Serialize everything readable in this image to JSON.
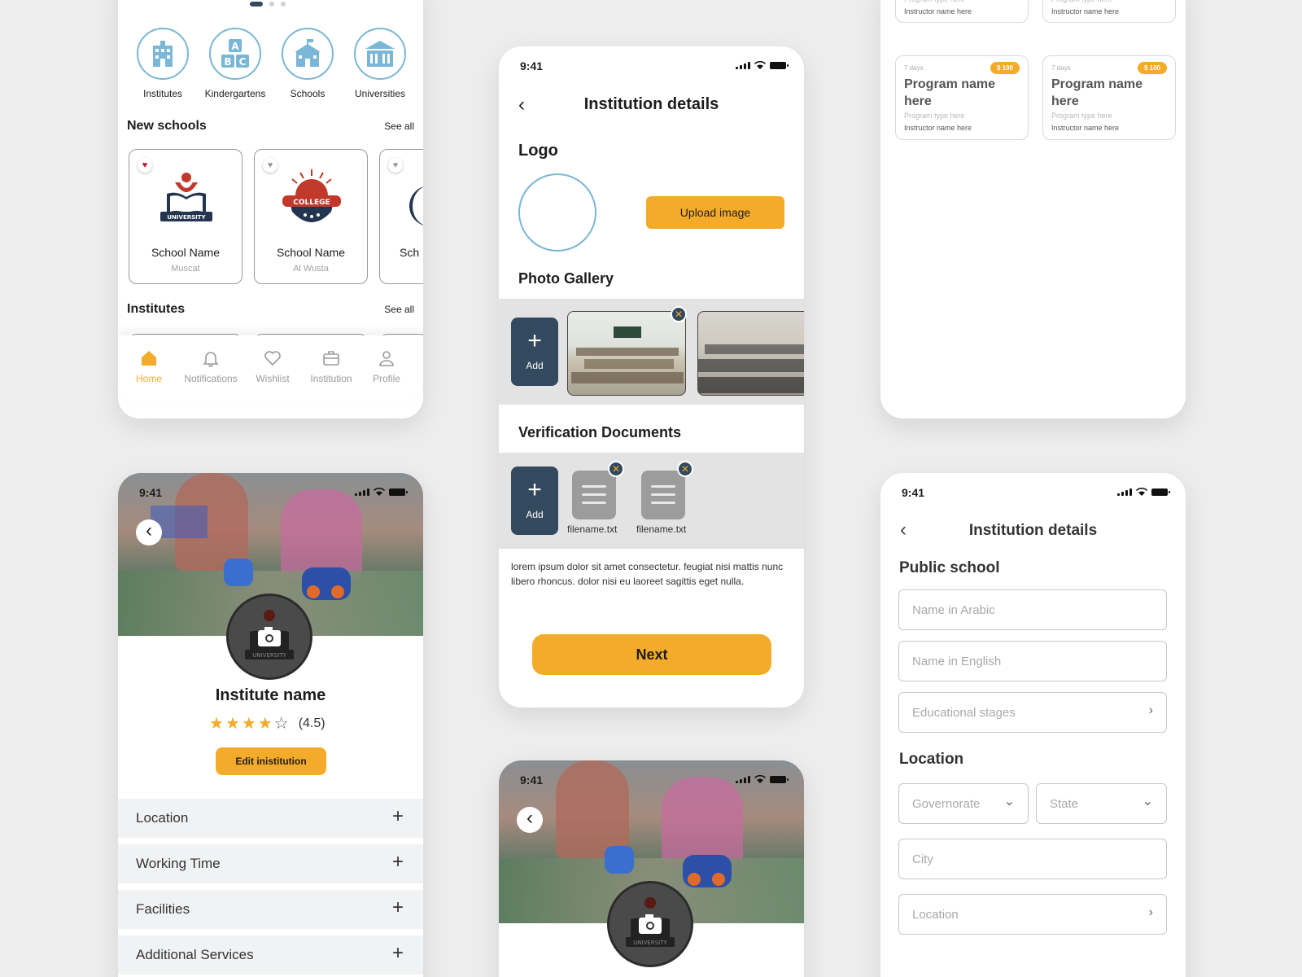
{
  "home": {
    "categories": [
      {
        "label": "Institutes",
        "icon": "building-icon"
      },
      {
        "label": "Kindergartens",
        "icon": "abc-blocks-icon"
      },
      {
        "label": "Schools",
        "icon": "school-icon"
      },
      {
        "label": "Universities",
        "icon": "university-icon"
      }
    ],
    "new_schools_title": "New schools",
    "see_all": "See all",
    "schools": [
      {
        "name": "School Name",
        "location": "Muscat"
      },
      {
        "name": "School Name",
        "location": "Al Wusta"
      },
      {
        "name": "Sch",
        "location": ""
      }
    ],
    "institutes_title": "Institutes",
    "badge_university": "UNIVERSITY",
    "badge_college": "COLLEGE",
    "tabs": [
      {
        "label": "Home",
        "icon": "home-icon",
        "active": true
      },
      {
        "label": "Notifications",
        "icon": "bell-icon",
        "active": false
      },
      {
        "label": "Wishlist",
        "icon": "heart-icon",
        "active": false
      },
      {
        "label": "Institution",
        "icon": "briefcase-icon",
        "active": false
      },
      {
        "label": "Profile",
        "icon": "user-icon",
        "active": false
      }
    ]
  },
  "details": {
    "time": "9:41",
    "title": "Institution details",
    "logo_title": "Logo",
    "upload_label": "Upload image",
    "gallery_title": "Photo Gallery",
    "add_label": "Add",
    "verification_title": "Verification Documents",
    "files": [
      "filename.txt",
      "filename.txt"
    ],
    "description": "lorem ipsum dolor sit amet consectetur. feugiat nisi mattis nunc libero rhoncus. dolor nisi eu laoreet sagittis eget nulla.",
    "next_label": "Next"
  },
  "programs": {
    "top_partial": [
      "here",
      "here"
    ],
    "type_text": "Program type here",
    "instructor_text": "Instructor name here",
    "cards": [
      {
        "days": "7 days",
        "price": "$ 100",
        "name": "Program name here"
      },
      {
        "days": "7 days",
        "price": "$ 100",
        "name": "Program name here"
      }
    ]
  },
  "profile": {
    "time": "9:41",
    "institute_name": "Institute name",
    "rating_text": "(4.5)",
    "rating": 4,
    "rating_max": 5,
    "edit_label": "Edit inistitution",
    "badge_text": "UNIVERSITY",
    "sections": [
      "Location",
      "Working Time",
      "Facilities",
      "Additional Services"
    ]
  },
  "profile2": {
    "time": "9:41",
    "badge_text": "UNIVERSITY"
  },
  "form": {
    "time": "9:41",
    "title": "Institution details",
    "section_public": "Public school",
    "name_ar": "Name in Arabic",
    "name_en": "Name in English",
    "stages": "Educational stages",
    "section_location": "Location",
    "governorate": "Governorate",
    "state": "State",
    "city": "City",
    "location": "Location"
  },
  "colors": {
    "accent": "#f5ab2a",
    "navy": "#33495e",
    "category_ring": "#7ab6d6",
    "favorite": "#c8102e"
  }
}
